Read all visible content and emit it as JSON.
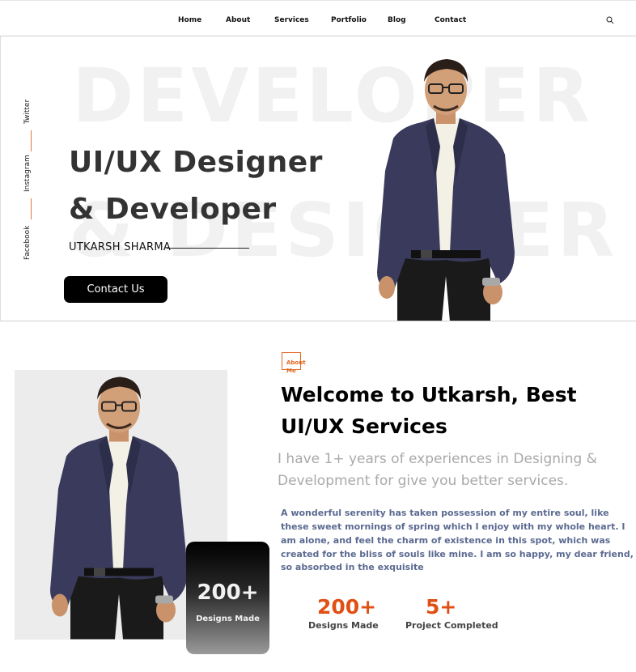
{
  "nav": {
    "items": [
      "Home",
      "About",
      "Services",
      "Portfolio",
      "Blog",
      "Contact"
    ],
    "search_icon": "search-icon"
  },
  "hero": {
    "bg_words": [
      "DEVELOPER",
      "& DESIGNER"
    ],
    "socials": [
      "Twitter",
      "Instagram",
      "Facebook"
    ],
    "title_line1": "UI/UX Designer",
    "title_line2": "& Developer",
    "name": "UTKARSH SHARMA",
    "cta": "Contact Us"
  },
  "about": {
    "tag": "About Me",
    "title_line1": "Welcome to Utkarsh, Best",
    "title_line2": "UI/UX Services",
    "subtitle_line1": "I have 1+ years of experiences in Designing &",
    "subtitle_line2": "Development for give you better services.",
    "paragraph": [
      "A wonderful serenity has taken possession of my entire soul, like",
      "these sweet mornings of spring which I enjoy with my whole heart. I",
      "am alone, and feel the charm of existence in this spot, which was",
      "created for the bliss of souls like mine. I am so happy, my dear friend,",
      "so absorbed in the exquisite"
    ],
    "card": {
      "value": "200+",
      "label": "Designs Made"
    },
    "metrics": [
      {
        "value": "200+",
        "label": "Designs Made"
      },
      {
        "value": "5+",
        "label": "Project Completed"
      }
    ]
  },
  "colors": {
    "accent": "#e04f14",
    "button_bg": "#000000",
    "paragraph": "#5b6a91",
    "muted": "#a9a9a9"
  }
}
